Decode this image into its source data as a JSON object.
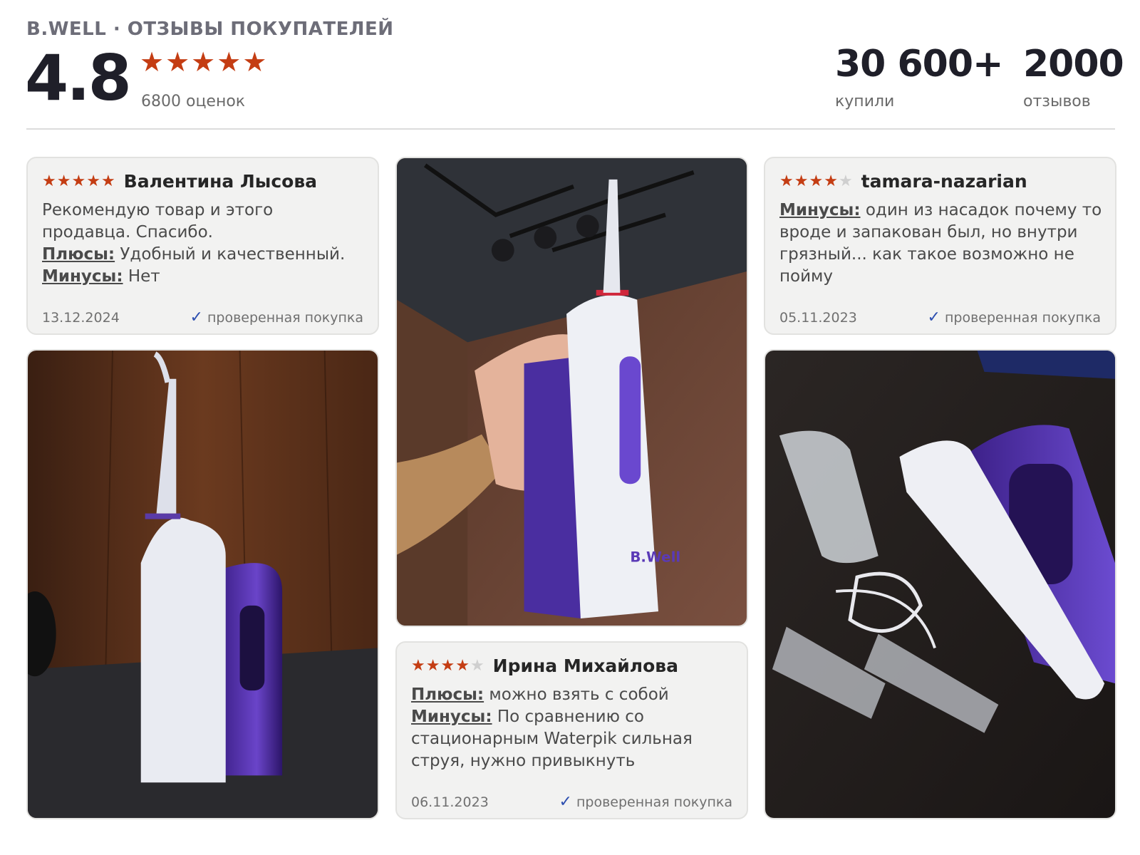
{
  "header": {
    "brand": "B.WELL · ОТЗЫВЫ ПОКУПАТЕЛЕЙ",
    "score": "4.8",
    "stars": 5,
    "ratings_count": "6800 оценок",
    "bought_value": "30 600+",
    "bought_label": "купили",
    "reviews_value": "2000",
    "reviews_label": "отзывов"
  },
  "reviews": [
    {
      "author": "Валентина Лысова",
      "stars": 5,
      "text": "Рекомендую товар и этого продавца. Спасибо.",
      "plus_label": "Плюсы:",
      "plus_text": " Удобный и качественный.",
      "minus_label": "Минусы:",
      "minus_text": " Нет",
      "date": "13.12.2024",
      "verified": "проверенная покупка"
    },
    {
      "author": "tamara-nazarian",
      "stars": 4,
      "minus_label": "Минусы:",
      "minus_text": " один из насадок почему то вроде и запакован был, но внутри грязный... как такое возможно не пойму",
      "date": "05.11.2023",
      "verified": "проверенная покупка"
    },
    {
      "author": "Ирина Михайлова",
      "stars": 4,
      "plus_label": "Плюсы:",
      "plus_text": " можно взять с собой",
      "minus_label": "Минусы:",
      "minus_text": " По сравнению со стационарным Waterpik сильная струя, нужно привыкнуть",
      "date": "06.11.2023",
      "verified": "проверенная покупка"
    }
  ],
  "photo_product_label": "B.Well",
  "colors": {
    "star": "#c43d13",
    "star_off": "#cfcfcf",
    "check": "#2d4fb0",
    "card_bg": "#f2f2f1"
  }
}
